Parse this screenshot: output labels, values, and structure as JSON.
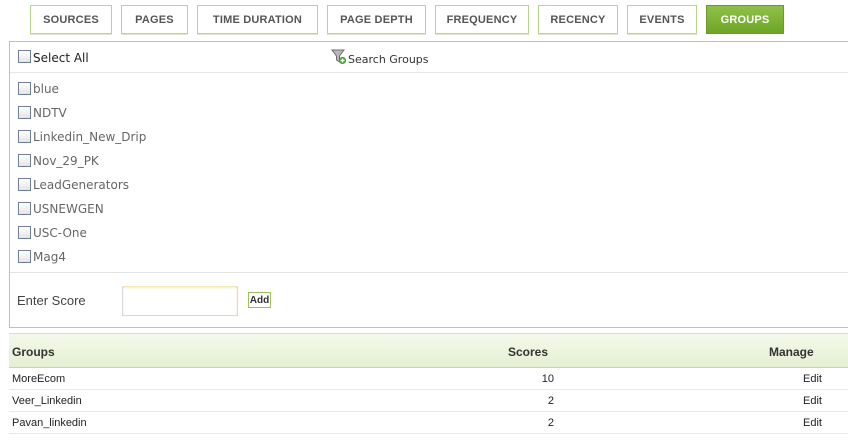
{
  "tabs": [
    {
      "label": "SOURCES",
      "active": false
    },
    {
      "label": "PAGES",
      "active": false
    },
    {
      "label": "TIME DURATION",
      "active": false
    },
    {
      "label": "PAGE DEPTH",
      "active": false
    },
    {
      "label": "FREQUENCY",
      "active": false
    },
    {
      "label": "RECENCY",
      "active": false
    },
    {
      "label": "EVENTS",
      "active": false
    },
    {
      "label": "GROUPS",
      "active": true
    }
  ],
  "panel": {
    "select_all_label": "Select All",
    "search_label": "Search Groups",
    "search_icon": "filter-add-icon",
    "groups": [
      {
        "label": "blue",
        "checked": false
      },
      {
        "label": "NDTV",
        "checked": false
      },
      {
        "label": "Linkedin_New_Drip",
        "checked": false
      },
      {
        "label": "Nov_29_PK",
        "checked": false
      },
      {
        "label": "LeadGenerators",
        "checked": false
      },
      {
        "label": "USNEWGEN",
        "checked": false
      },
      {
        "label": "USC-One",
        "checked": false
      },
      {
        "label": "Mag4",
        "checked": false
      }
    ],
    "score_label": "Enter Score",
    "score_value": "",
    "add_label": "Add"
  },
  "table": {
    "headers": {
      "groups": "Groups",
      "scores": "Scores",
      "manage": "Manage"
    },
    "rows": [
      {
        "group": "MoreEcom",
        "score": "10",
        "action": "Edit"
      },
      {
        "group": "Veer_Linkedin",
        "score": "2",
        "action": "Edit"
      },
      {
        "group": "Pavan_linkedin",
        "score": "2",
        "action": "Edit"
      }
    ]
  },
  "colors": {
    "accent": "#7ab034",
    "tab_border": "#b9d48c",
    "table_header_bg": "#e9f2d9"
  }
}
